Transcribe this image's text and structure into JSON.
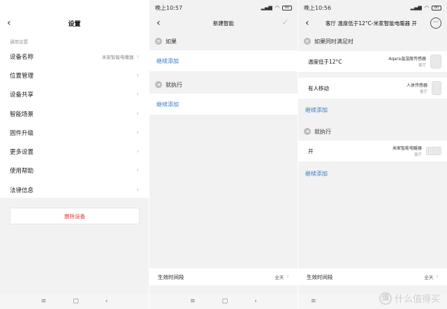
{
  "panel1": {
    "title": "设置",
    "section_label": "通用设置",
    "items": [
      {
        "label": "设备名称",
        "value": "米家智能电暖器"
      },
      {
        "label": "位置管理",
        "value": ""
      },
      {
        "label": "设备共享",
        "value": ""
      },
      {
        "label": "智能场景",
        "value": ""
      },
      {
        "label": "固件升级",
        "value": ""
      },
      {
        "label": "更多设置",
        "value": ""
      },
      {
        "label": "使用帮助",
        "value": ""
      },
      {
        "label": "法律信息",
        "value": ""
      }
    ],
    "delete_label": "删除设备"
  },
  "panel2": {
    "status_time": "晚上10:57",
    "battery": "80",
    "title": "新建智能",
    "if_label": "如果",
    "then_label": "就执行",
    "add_label": "继续添加",
    "add_label2": "继续添加",
    "bottom_label": "生效时间段",
    "bottom_value": "全天"
  },
  "panel3": {
    "status_time": "晚上10:56",
    "battery": "80",
    "title": "客厅 温度低于12°C-米家智能电暖器 开",
    "if_label": "如果同时满足时",
    "conditions": [
      {
        "label": "温度低于12°C",
        "device": "Aqara温湿度传感器",
        "room": "客厅"
      },
      {
        "label": "有人移动",
        "device": "人体传感器",
        "room": "客厅"
      }
    ],
    "add_label": "继续添加",
    "then_label": "就执行",
    "action": {
      "label": "开",
      "device": "米家智能电暖器",
      "room": "客厅"
    },
    "add_label2": "继续添加",
    "bottom_label": "生效时间段",
    "bottom_value": "全天",
    "watermark": "值 | 什么值得买"
  }
}
